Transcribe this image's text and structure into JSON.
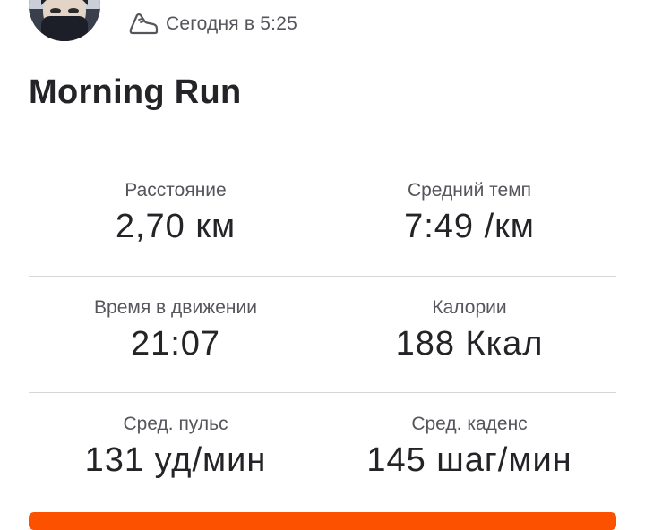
{
  "activity": {
    "time_text": "Сегодня в 5:25",
    "title": "Morning Run"
  },
  "icons": {
    "avatar": "athlete-avatar",
    "activity_type": "running-shoe-icon"
  },
  "stats": [
    {
      "label": "Расстояние",
      "value": "2,70 км"
    },
    {
      "label": "Средний темп",
      "value": "7:49 /км"
    },
    {
      "label": "Время в движении",
      "value": "21:07"
    },
    {
      "label": "Калории",
      "value": "188 Ккал"
    },
    {
      "label": "Сред. пульс",
      "value": "131 уд/мин"
    },
    {
      "label": "Сред. каденс",
      "value": "145 шаг/мин"
    }
  ],
  "colors": {
    "accent": "#fc5200",
    "text_primary": "#242428",
    "text_secondary": "#55555c",
    "divider": "#d6d6d8"
  }
}
